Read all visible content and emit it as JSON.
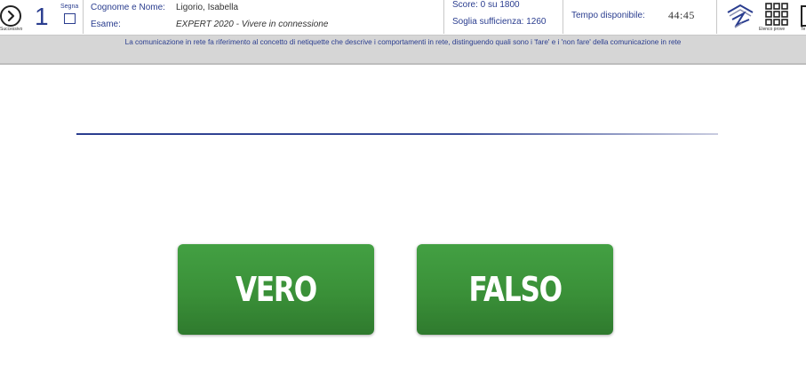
{
  "header": {
    "next_label": "Successivo",
    "question_number": "1",
    "segna_label": "Segna",
    "name_label": "Cognome e Nome:",
    "name_value": "Ligorio, Isabella",
    "exam_label": "Esame:",
    "exam_value": "EXPERT 2020 - Vivere in connessione",
    "score_text": "Score: 0 su 1800",
    "threshold_text": "Soglia sufficienza: 1260",
    "time_label": "Tempo disponibile:",
    "time_value": "44:45",
    "grid_label": "Elenco prove",
    "last_label": "Te",
    "icons": {
      "next": "chevron-right-circle-icon",
      "flag": "checkbox-icon",
      "logo": "brand-logo-icon",
      "grid": "grid-icon"
    }
  },
  "question": {
    "text": "La comunicazione in rete fa riferimento al concetto di netiquette che descrive i comportamenti in rete, distinguendo quali sono i 'fare' e i 'non fare' della comunicazione in rete"
  },
  "answers": {
    "true_label": "VERO",
    "false_label": "FALSO"
  },
  "colors": {
    "accent": "#2a3d8f",
    "button_green": "#3a9038",
    "question_bar": "#d6d6d6"
  }
}
